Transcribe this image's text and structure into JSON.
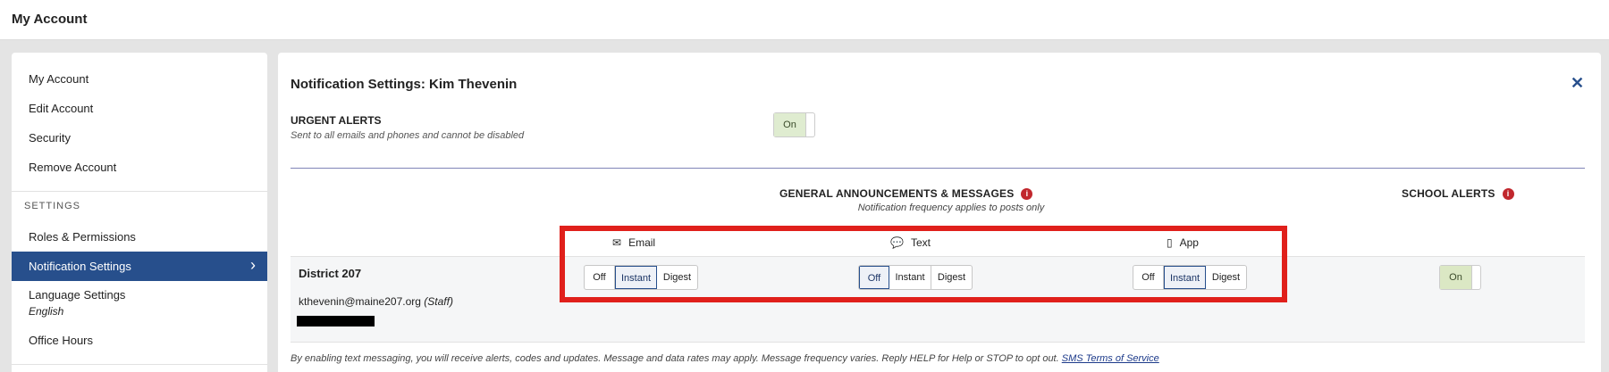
{
  "header": {
    "title": "My Account"
  },
  "sidebar": {
    "items": [
      {
        "label": "My Account"
      },
      {
        "label": "Edit Account"
      },
      {
        "label": "Security"
      },
      {
        "label": "Remove Account"
      }
    ],
    "settings_heading": "SETTINGS",
    "settings_items": [
      {
        "label": "Roles & Permissions"
      },
      {
        "label": "Notification Settings",
        "active": true
      },
      {
        "label": "Language Settings",
        "sublabel": "English"
      },
      {
        "label": "Office Hours"
      }
    ],
    "active_color": "#274f8c"
  },
  "panel": {
    "title": "Notification Settings: Kim Thevenin",
    "urgent": {
      "title": "URGENT ALERTS",
      "subtitle": "Sent to all emails and phones and cannot be disabled",
      "toggle_label": "On"
    },
    "general": {
      "heading": "GENERAL ANNOUNCEMENTS & MESSAGES",
      "note": "Notification frequency applies to posts only"
    },
    "school_alerts": {
      "heading": "SCHOOL ALERTS"
    },
    "info_icon": "i",
    "channels": [
      {
        "label": "Email",
        "icon": "envelope-icon",
        "glyph": "✉"
      },
      {
        "label": "Text",
        "icon": "speech-bubble-icon",
        "glyph": "💬"
      },
      {
        "label": "App",
        "icon": "phone-icon",
        "glyph": "▯"
      }
    ],
    "options": [
      "Off",
      "Instant",
      "Digest"
    ],
    "district": {
      "name": "District 207",
      "email": "kthevenin@maine207.org",
      "role": "(Staff)",
      "email_selected": "Instant",
      "text_selected": "Off",
      "app_selected": "Instant",
      "school_alerts_toggle": "On"
    },
    "footer": {
      "text": "By enabling text messaging, you will receive alerts, codes and updates. Message and data rates may apply. Message frequency varies. Reply HELP for Help or STOP to opt out.",
      "link": "SMS Terms of Service"
    },
    "close_icon": "✕",
    "highlight_color": "#e0201b"
  }
}
